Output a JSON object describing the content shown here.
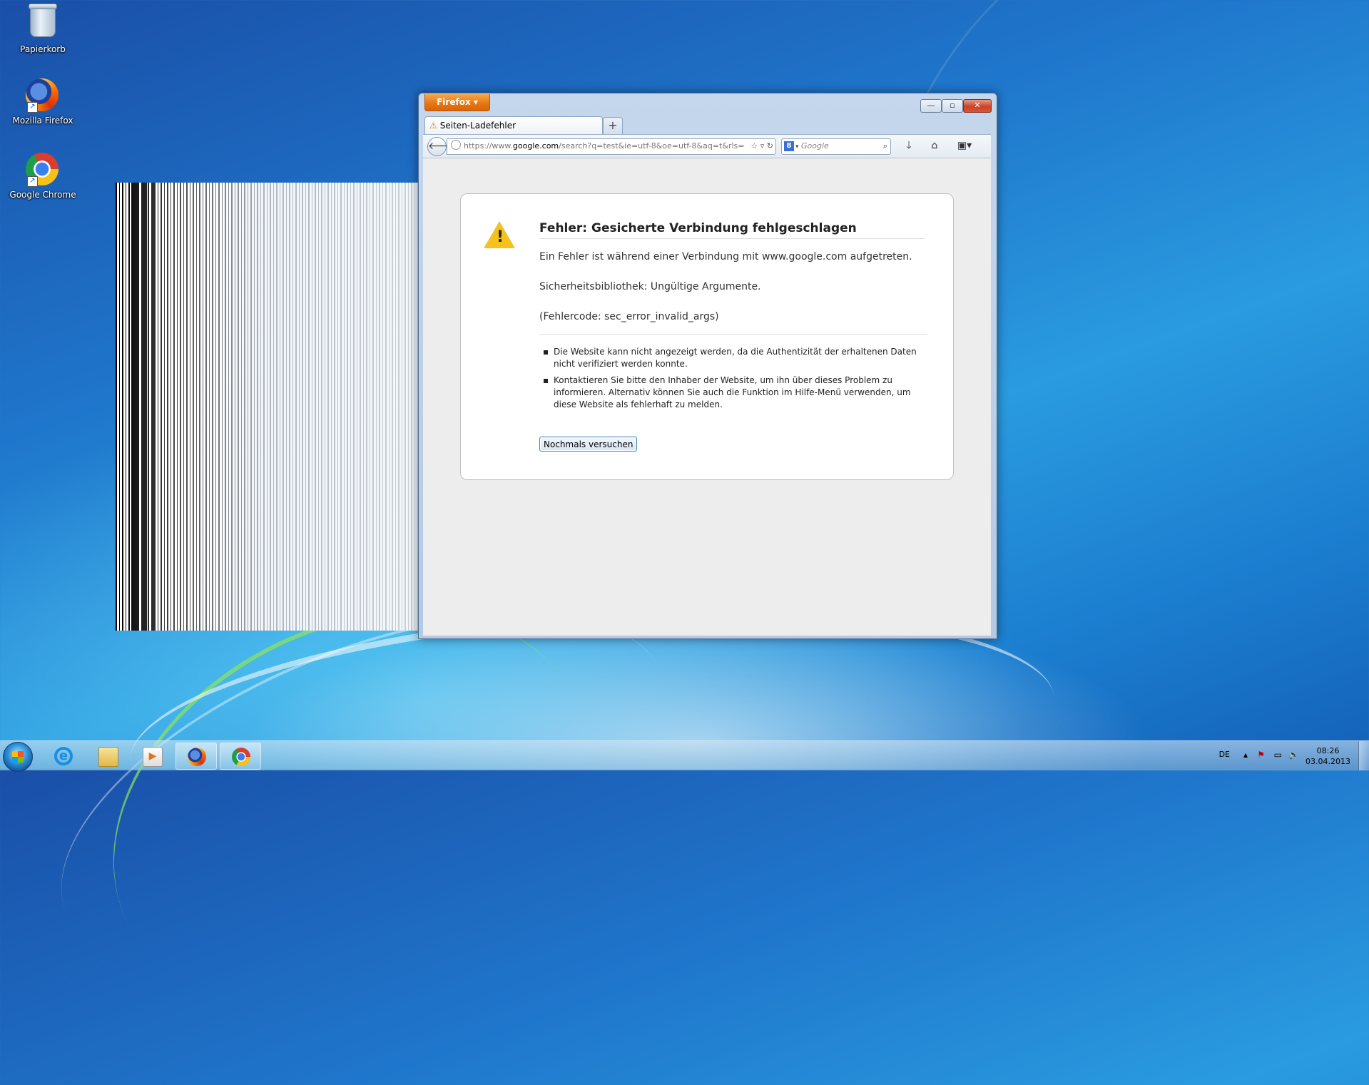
{
  "desktop": {
    "icons": [
      {
        "label": "Papierkorb",
        "icon": "recycle-bin-icon"
      },
      {
        "label": "Mozilla Firefox",
        "icon": "firefox-icon"
      },
      {
        "label": "Google Chrome",
        "icon": "chrome-icon"
      }
    ]
  },
  "browser": {
    "menu_button": "Firefox ▾",
    "tab_title": "Seiten-Ladefehler",
    "new_tab": "+",
    "url_prefix": "https://www.",
    "url_domain": "google.com",
    "url_rest": "/search?q=test&ie=utf-8&oe=utf-8&aq=t&rls=",
    "search_engine_badge": "8",
    "search_placeholder": "Google",
    "error": {
      "title": "Fehler: Gesicherte Verbindung fehlgeschlagen",
      "line1": "Ein Fehler ist während einer Verbindung mit www.google.com aufgetreten.",
      "line2": "Sicherheitsbibliothek: Ungültige Argumente.",
      "line3": "(Fehlercode: sec_error_invalid_args)",
      "bullet1": "Die Website kann nicht angezeigt werden, da die Authentizität der erhaltenen Daten nicht verifiziert werden konnte.",
      "bullet2": "Kontaktieren Sie bitte den Inhaber der Website, um ihn über dieses Problem zu informieren. Alternativ können Sie auch die Funktion im Hilfe-Menü verwenden, um diese Website als fehlerhaft zu melden.",
      "retry_button": "Nochmals versuchen"
    }
  },
  "taskbar": {
    "language": "DE",
    "time": "08:26",
    "date": "03.04.2013"
  },
  "colors": {
    "firefox_orange": "#e6740f",
    "desktop_blue": "#1f77cc",
    "warning_yellow": "#f3c21e"
  }
}
